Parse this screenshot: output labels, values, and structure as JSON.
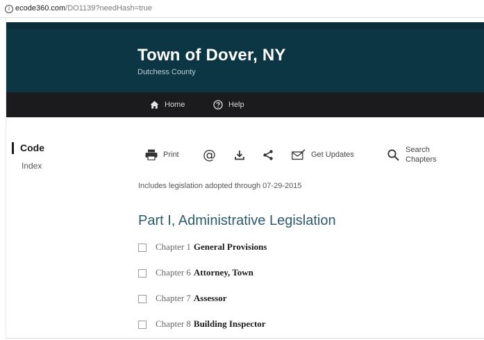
{
  "browser": {
    "url_host": "ecode360.com",
    "url_path": "/DO1139?needHash=true",
    "info_icon": "info-icon"
  },
  "header": {
    "title": "Town of Dover, NY",
    "subtitle": "Dutchess County",
    "bg_color": "#0d3644"
  },
  "nav": {
    "home_label": "Home",
    "help_label": "Help"
  },
  "sidebar": {
    "code_label": "Code",
    "index_label": "Index"
  },
  "toolbar": {
    "print_label": "Print",
    "updates_label": "Get Updates",
    "search_label_1": "Search",
    "search_label_2": "Chapters",
    "icons": [
      "printer-icon",
      "at-icon",
      "download-icon",
      "share-icon",
      "envelope-icon",
      "search-icon"
    ]
  },
  "main": {
    "legislation_note": "Includes legislation adopted through 07-29-2015",
    "part_title": "Part I, Administrative Legislation",
    "chapters": [
      {
        "num": "Chapter 1",
        "name": "General Provisions"
      },
      {
        "num": "Chapter 6",
        "name": "Attorney, Town"
      },
      {
        "num": "Chapter 7",
        "name": "Assessor"
      },
      {
        "num": "Chapter 8",
        "name": "Building Inspector"
      }
    ]
  }
}
